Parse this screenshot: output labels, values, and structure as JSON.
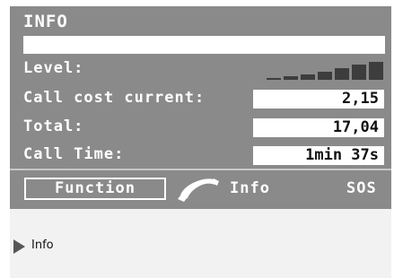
{
  "screen": {
    "title": "INFO",
    "colors": {
      "panel": "#8a8a8a",
      "text": "#ffffff",
      "bars": "#3d3d3d",
      "bottom": "#f2f2f2"
    }
  },
  "level": {
    "label": "Level:",
    "bars": 7,
    "icon": "signal-strength-icon"
  },
  "rows": {
    "call_cost_current": {
      "label": "Call cost current:",
      "value": "2,15"
    },
    "total": {
      "label": "Total:",
      "value": "17,04"
    },
    "call_time": {
      "label": "Call Time:",
      "value": "1min 37s"
    }
  },
  "softkeys": {
    "function": "Function",
    "phone_icon": "phone-handset-icon",
    "info": "Info",
    "sos": "SOS"
  },
  "bottom": {
    "icon": "play-arrow-icon",
    "label": "Info"
  }
}
